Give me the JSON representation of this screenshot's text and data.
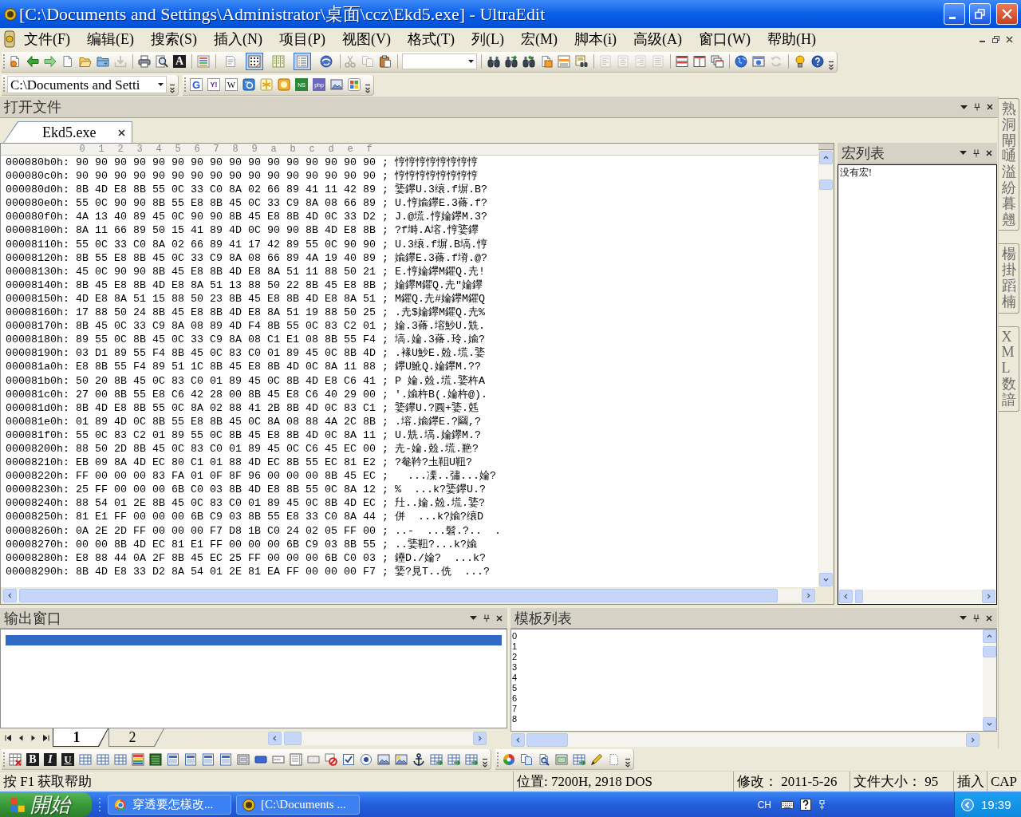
{
  "window": {
    "title": "[C:\\Documents and Settings\\Administrator\\桌面\\ccz\\Ekd5.exe] - UltraEdit"
  },
  "menu": {
    "items": [
      "文件(F)",
      "编辑(E)",
      "搜索(S)",
      "插入(N)",
      "项目(P)",
      "视图(V)",
      "格式(T)",
      "列(L)",
      "宏(M)",
      "脚本(i)",
      "高级(A)",
      "窗口(W)",
      "帮助(H)"
    ]
  },
  "main_toolbar": {
    "buttons": [
      {
        "pressed": false,
        "disabled": false
      },
      {
        "pressed": false,
        "disabled": false
      },
      {
        "pressed": false,
        "disabled": false
      },
      {
        "pressed": false,
        "disabled": false
      },
      {
        "pressed": false,
        "disabled": false
      },
      {
        "pressed": false,
        "disabled": false
      },
      {
        "pressed": false,
        "disabled": true
      },
      {
        "pressed": false,
        "disabled": false
      },
      {
        "pressed": false,
        "disabled": false
      },
      {
        "glyph": "A",
        "pressed": false,
        "disabled": false
      },
      {
        "pressed": false,
        "disabled": false
      },
      {
        "pressed": false,
        "disabled": false
      },
      {
        "pressed": true,
        "disabled": false
      },
      {
        "pressed": false,
        "disabled": false
      },
      {
        "pressed": true,
        "disabled": false
      },
      {
        "pressed": false,
        "disabled": false
      },
      {
        "pressed": false,
        "disabled": true
      },
      {
        "pressed": false,
        "disabled": true
      },
      {
        "pressed": false,
        "disabled": false
      },
      {
        "pressed": false,
        "disabled": false
      },
      {
        "pressed": false,
        "disabled": false
      },
      {
        "pressed": false,
        "disabled": false
      },
      {
        "pressed": false,
        "disabled": false
      },
      {
        "pressed": false,
        "disabled": false
      },
      {
        "pressed": false,
        "disabled": false
      },
      {
        "pressed": false,
        "disabled": true
      },
      {
        "pressed": false,
        "disabled": true
      },
      {
        "pressed": false,
        "disabled": true
      },
      {
        "pressed": false,
        "disabled": true
      },
      {
        "pressed": false,
        "disabled": false
      },
      {
        "pressed": false,
        "disabled": false
      },
      {
        "pressed": false,
        "disabled": false
      },
      {
        "pressed": false,
        "disabled": false
      },
      {
        "pressed": false,
        "disabled": false
      },
      {
        "pressed": false,
        "disabled": true
      },
      {
        "pressed": false,
        "disabled": false
      },
      {
        "pressed": false,
        "disabled": false
      }
    ]
  },
  "path_toolbar": {
    "path": "C:\\Documents and Setti"
  },
  "link_toolbar": {
    "labels": [
      "G",
      "Y!",
      "W",
      "NS",
      "php"
    ]
  },
  "open_files": {
    "title": "打开文件",
    "tabs": [
      {
        "label": "Ekd5.exe",
        "selected": true
      }
    ]
  },
  "hex_editor": {
    "columns": [
      "0",
      "1",
      "2",
      "3",
      "4",
      "5",
      "6",
      "7",
      "8",
      "9",
      "a",
      "b",
      "c",
      "d",
      "e",
      "f"
    ],
    "rows": [
      {
        "offset": "000080b0h:",
        "bytes": "90 90 90 90 90 90 90 90 90 90 90 90 90 90 90 90",
        "text": "; 悙悙悙悙悙悙悙悙"
      },
      {
        "offset": "000080c0h:",
        "bytes": "90 90 90 90 90 90 90 90 90 90 90 90 90 90 90 90",
        "text": "; 悙悙悙悙悙悙悙悙"
      },
      {
        "offset": "000080d0h:",
        "bytes": "8B 4D E8 8B 55 0C 33 C0 8A 02 66 89 41 11 42 89",
        "text": "; 婱鑻U.3缞.f塀.B?"
      },
      {
        "offset": "000080e0h:",
        "bytes": "55 0C 90 90 8B 55 E8 8B 45 0C 33 C9 8A 08 66 89",
        "text": "; U.悙婾鑻E.3蓨.f?"
      },
      {
        "offset": "000080f0h:",
        "bytes": "4A 13 40 89 45 0C 90 90 8B 45 E8 8B 4D 0C 33 D2",
        "text": "; J.@塃.悙婨鑻M.3?"
      },
      {
        "offset": "00008100h:",
        "bytes": "8A 11 66 89 50 15 41 89 4D 0C 90 90 8B 4D E8 8B",
        "text": "; ?f塒.A塎.悙婱鑻"
      },
      {
        "offset": "00008110h:",
        "bytes": "55 0C 33 C0 8A 02 66 89 41 17 42 89 55 0C 90 90",
        "text": "; U.3缞.f塀.B塙.悙"
      },
      {
        "offset": "00008120h:",
        "bytes": "8B 55 E8 8B 45 0C 33 C9 8A 08 66 89 4A 19 40 89",
        "text": "; 婾鑻E.3蓨.f塉.@?"
      },
      {
        "offset": "00008130h:",
        "bytes": "45 0C 90 90 8B 45 E8 8B 4D E8 8A 51 11 88 50 21",
        "text": "; E.悙婨鑻M鑺Q.圥!"
      },
      {
        "offset": "00008140h:",
        "bytes": "8B 45 E8 8B 4D E8 8A 51 13 88 50 22 8B 45 E8 8B",
        "text": "; 婨鑻M鑺Q.圥\"婨鑻"
      },
      {
        "offset": "00008150h:",
        "bytes": "4D E8 8A 51 15 88 50 23 8B 45 E8 8B 4D E8 8A 51",
        "text": "; M鑺Q.圥#婨鑻M鑺Q"
      },
      {
        "offset": "00008160h:",
        "bytes": "17 88 50 24 8B 45 E8 8B 4D E8 8A 51 19 88 50 25",
        "text": "; .圥$婨鑻M鑺Q.圥%"
      },
      {
        "offset": "00008170h:",
        "bytes": "8B 45 0C 33 C9 8A 08 89 4D F4 8B 55 0C 83 C2 01",
        "text": "; 婨.3蓨.塎魦U.兟."
      },
      {
        "offset": "00008180h:",
        "bytes": "89 55 0C 8B 45 0C 33 C9 8A 08 C1 E1 08 8B 55 F4",
        "text": "; 塙.婨.3蓨.玲.婾?"
      },
      {
        "offset": "00008190h:",
        "bytes": "03 D1 89 55 F4 8B 45 0C 83 C0 01 89 45 0C 8B 4D",
        "text": "; .褖U魦E.兝.塃.婱"
      },
      {
        "offset": "000081a0h:",
        "bytes": "E8 8B 55 F4 89 51 1C 8B 45 E8 8B 4D 0C 8A 11 88",
        "text": "; 鑻U魤Q.婨鑻M.??"
      },
      {
        "offset": "000081b0h:",
        "bytes": "50 20 8B 45 0C 83 C0 01 89 45 0C 8B 4D E8 C6 41",
        "text": "; P 婨.兝.塃.婱杵A"
      },
      {
        "offset": "000081c0h:",
        "bytes": "27 00 8B 55 E8 C6 42 28 00 8B 45 E8 C6 40 29 00",
        "text": "; '.婾杵B(.婨杵@)."
      },
      {
        "offset": "000081d0h:",
        "bytes": "8B 4D E8 8B 55 0C 8A 02 88 41 2B 8B 4D 0C 83 C1",
        "text": "; 婱鑻U.?圓+婱.兞"
      },
      {
        "offset": "000081e0h:",
        "bytes": "01 89 4D 0C 8B 55 E8 8B 45 0C 8A 08 88 4A 2C 8B",
        "text": "; .塎.婾鑻E.?圝,?"
      },
      {
        "offset": "000081f0h:",
        "bytes": "55 0C 83 C2 01 89 55 0C 8B 45 E8 8B 4D 0C 8A 11",
        "text": "; U.兟.塙.婨鑻M.?"
      },
      {
        "offset": "00008200h:",
        "bytes": "88 50 2D 8B 45 0C 83 C0 01 89 45 0C C6 45 EC 00",
        "text": "; 圥-婨.兝.塃.艵?"
      },
      {
        "offset": "00008210h:",
        "bytes": "EB 09 8A 4D EC 80 C1 01 88 4D EC 8B 55 EC 81 E2",
        "text": "; ?奙靲?圡靻U靵?"
      },
      {
        "offset": "00008220h:",
        "bytes": "FF 00 00 00 83 FA 01 0F 8F 96 00 00 00 8B 45 EC",
        "text": ";   ...凓..彇...婨?"
      },
      {
        "offset": "00008230h:",
        "bytes": "25 FF 00 00 00 6B C0 03 8B 4D E8 8B 55 0C 8A 12",
        "text": "; %  ...k?婱鑻U.?"
      },
      {
        "offset": "00008240h:",
        "bytes": "88 54 01 2E 8B 45 0C 83 C0 01 89 45 0C 8B 4D EC",
        "text": "; 圱..婨.兝.塃.婱?"
      },
      {
        "offset": "00008250h:",
        "bytes": "81 E1 FF 00 00 00 6B C9 03 8B 55 E8 33 C0 8A 44",
        "text": "; 併  ...k?婾?缞D"
      },
      {
        "offset": "00008260h:",
        "bytes": "0A 2E 2D FF 00 00 00 F7 D8 1B C0 24 02 05 FF 00",
        "text": "; ..-  ...髫.?..  ."
      },
      {
        "offset": "00008270h:",
        "bytes": "00 00 8B 4D EC 81 E1 FF 00 00 00 6B C9 03 8B 55",
        "text": "; ..婱靵?...k?婾"
      },
      {
        "offset": "00008280h:",
        "bytes": "E8 88 44 0A 2F 8B 45 EC 25 FF 00 00 00 6B C0 03",
        "text": "; 鑸D./婨?  ...k?"
      },
      {
        "offset": "00008290h:",
        "bytes": "8B 4D E8 33 D2 8A 54 01 2E 81 EA FF 00 00 00 F7",
        "text": "; 婱?見T..侁  ...?"
      }
    ]
  },
  "macro_list": {
    "title": "宏列表",
    "message": "没有宏!"
  },
  "side_tabs": [
    {
      "label": "熟洞閘嗵溢紛暮翹"
    },
    {
      "label": "楊掛蹈楠"
    },
    {
      "label": "XML 数諳"
    }
  ],
  "output_window": {
    "title": "输出窗口",
    "lines": [
      {
        "selected": true
      }
    ],
    "tabs": [
      {
        "label": "1",
        "selected": true
      },
      {
        "label": "2",
        "selected": false
      }
    ]
  },
  "template_list": {
    "title": "模板列表",
    "items": [
      "0",
      "1",
      "2",
      "3",
      "4",
      "5",
      "6",
      "7",
      "8"
    ]
  },
  "format_toolbar": {
    "labels": [
      "B",
      "I",
      "U"
    ]
  },
  "status_bar": {
    "panes": [
      "按 F1 获取帮助",
      "位置: 7200H, 2918 DOS",
      "修改： 2011-5-26",
      "文件大小： 95",
      "插入",
      "CAP"
    ]
  },
  "taskbar": {
    "start": "開始",
    "tasks": [
      "穿透要怎樣改...",
      "[C:\\Documents ..."
    ],
    "language": "CH",
    "clock": "19:39"
  }
}
